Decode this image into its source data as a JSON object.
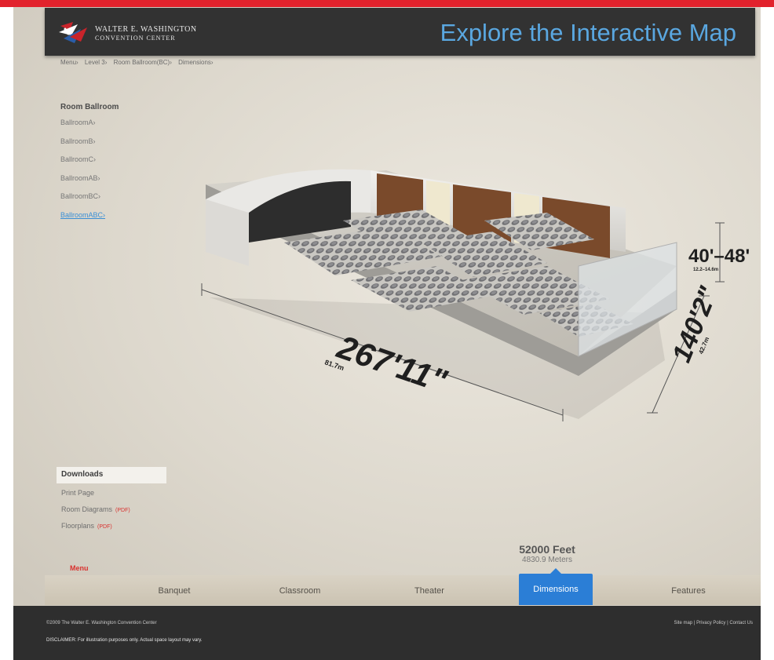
{
  "header": {
    "logo_line1": "WALTER E. WASHINGTON",
    "logo_line2": "CONVENTION CENTER",
    "title": "Explore the Interactive Map"
  },
  "breadcrumb": [
    "Menu›",
    "Level 3›",
    "Room Ballroom(BC)›",
    "Dimensions›"
  ],
  "room_menu": {
    "title": "Room Ballroom",
    "items": [
      {
        "label": "BallroomA›"
      },
      {
        "label": "BallroomB›"
      },
      {
        "label": "BallroomC›"
      },
      {
        "label": "BallroomAB›"
      },
      {
        "label": "BallroomBC›"
      },
      {
        "label": "BallroomABC›"
      }
    ],
    "active_item": "BallroomABC›"
  },
  "dimensions": {
    "length": "267'11\"",
    "length_m": "81.7m",
    "width": "140'2\"",
    "width_m": "42.7m",
    "height": "40'–48'",
    "height_m": "12.2–14.6m"
  },
  "downloads": {
    "heading": "Downloads",
    "print": "Print Page",
    "room_diagrams": "Room Diagrams",
    "floorplans": "Floorplans",
    "pdf_tag": "(PDF)"
  },
  "menu_label": "Menu",
  "stat": {
    "feet": "52000 Feet",
    "meters": "4830.9 Meters"
  },
  "tabs": [
    {
      "label": "Banquet"
    },
    {
      "label": "Classroom"
    },
    {
      "label": "Theater"
    },
    {
      "label": "Dimensions"
    },
    {
      "label": "Features"
    }
  ],
  "active_tab": "Dimensions",
  "footer": {
    "copyright": "©2009 The Walter E. Washington Convention Center",
    "sitemap": "Site map",
    "privacy": "Privacy Policy",
    "contact": "Contact Us",
    "separator": "|",
    "disclaimer": "DISCLAIMER: For illustration purposes only. Actual space layout may vary."
  },
  "colors": {
    "accent_red": "#e2222c",
    "accent_blue": "#2b7ed6",
    "title_blue": "#5aa7e0",
    "header_bg": "#323232",
    "footer_bg": "#2e2e2e"
  }
}
